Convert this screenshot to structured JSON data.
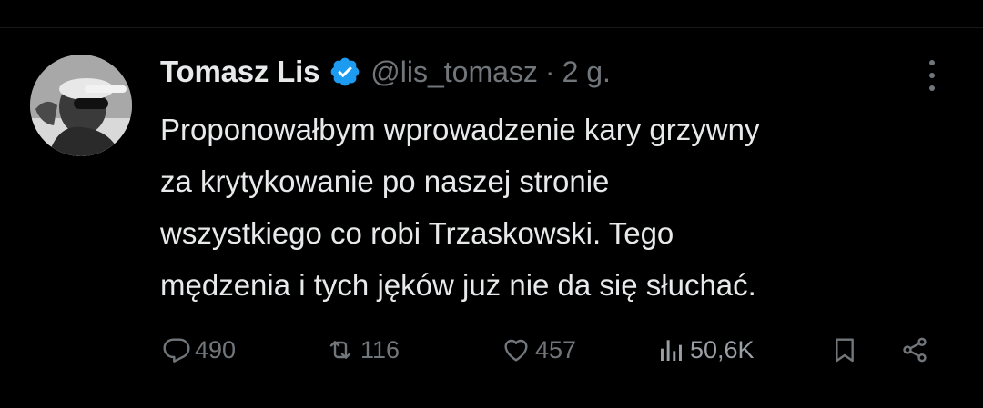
{
  "tweet": {
    "author": {
      "display_name": "Tomasz Lis",
      "handle": "@lis_tomasz",
      "verified": true,
      "avatar_icon": "avatar-photo"
    },
    "separator": "·",
    "timestamp": "2 g.",
    "text_lines": [
      "Proponowałbym wprowadzenie kary grzywny",
      "za krytykowanie po naszej stronie",
      "wszystkiego co robi Trzaskowski. Tego",
      "mędzenia i tych jęków już nie da się słuchać."
    ],
    "actions": {
      "reply_count": "490",
      "repost_count": "116",
      "like_count": "457",
      "view_count": "50,6K"
    },
    "icons": {
      "verified": "verified-badge-icon",
      "more": "more-options-icon",
      "reply": "reply-icon",
      "repost": "repost-icon",
      "like": "heart-icon",
      "views": "views-chart-icon",
      "bookmark": "bookmark-icon",
      "share": "share-icon"
    },
    "colors": {
      "background": "#000000",
      "primary_text": "#e7e9ea",
      "secondary_text": "#71767b",
      "verified_blue": "#1d9bf0"
    }
  }
}
